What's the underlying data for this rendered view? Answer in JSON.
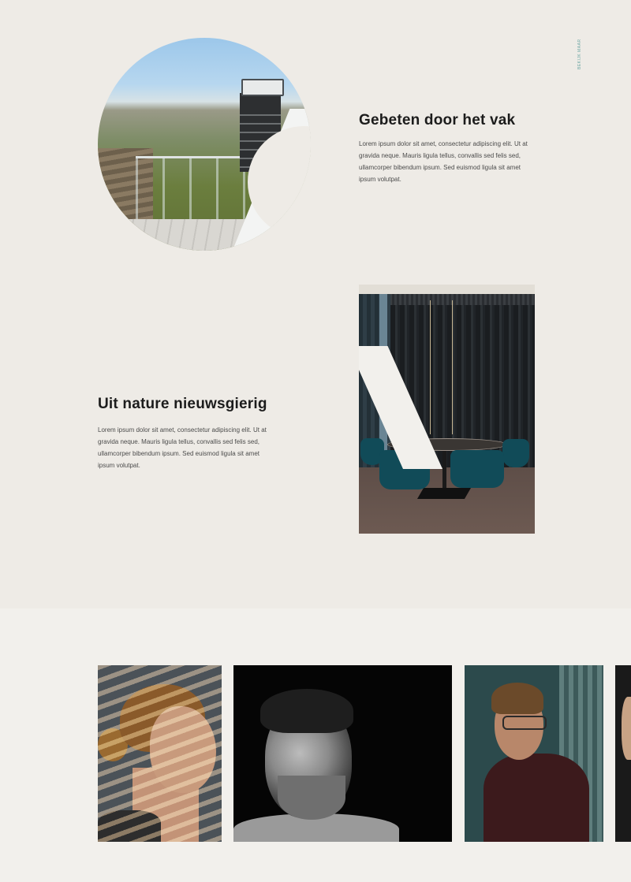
{
  "side_label": "BEKIJK MAAR",
  "features": [
    {
      "title": "Gebeten door het vak",
      "body": "Lorem ipsum dolor sit amet, consectetur adipiscing elit. Ut at gravida neque. Mauris ligula tellus, convallis sed felis sed, ullamcorper bibendum ipsum. Sed euismod ligula sit amet ipsum volutpat."
    },
    {
      "title": "Uit nature nieuwsgierig",
      "body": "Lorem ipsum dolor sit amet, consectetur adipiscing elit. Ut at gravida neque. Mauris ligula tellus, convallis sed felis sed, ullamcorper bibendum ipsum. Sed euismod ligula sit amet ipsum volutpat."
    }
  ],
  "colors": {
    "background": "#eeebe6",
    "section_background": "#f2f0ec",
    "heading": "#1c1c1c",
    "body_text": "#4b4b4b",
    "accent": "#6fa7a4"
  }
}
